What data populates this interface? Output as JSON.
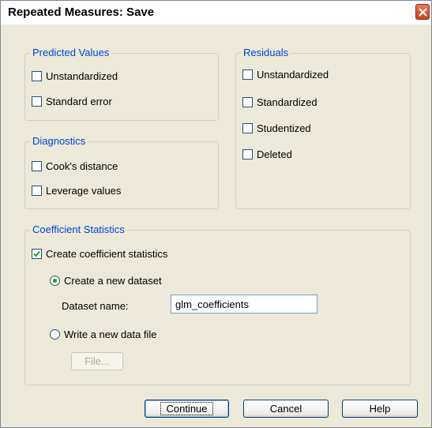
{
  "window": {
    "title": "Repeated Measures: Save"
  },
  "predicted_values": {
    "title": "Predicted Values",
    "options": [
      {
        "label": "Unstandardized",
        "checked": false
      },
      {
        "label": "Standard error",
        "checked": false
      }
    ]
  },
  "diagnostics": {
    "title": "Diagnostics",
    "options": [
      {
        "label": "Cook's distance",
        "checked": false
      },
      {
        "label": "Leverage values",
        "checked": false
      }
    ]
  },
  "residuals": {
    "title": "Residuals",
    "options": [
      {
        "label": "Unstandardized",
        "checked": false
      },
      {
        "label": "Standardized",
        "checked": false
      },
      {
        "label": "Studentized",
        "checked": false
      },
      {
        "label": "Deleted",
        "checked": false
      }
    ]
  },
  "coefficient_statistics": {
    "title": "Coefficient Statistics",
    "create_checkbox": {
      "label": "Create coefficient statistics",
      "checked": true
    },
    "create_dataset_radio": {
      "label": "Create a new dataset",
      "selected": true
    },
    "dataset_name_label": "Dataset name:",
    "dataset_name_value": "glm_coefficients",
    "write_file_radio": {
      "label": "Write a new data file",
      "selected": false
    },
    "file_button": "File..."
  },
  "buttons": {
    "continue": "Continue",
    "cancel": "Cancel",
    "help": "Help"
  },
  "colors": {
    "group_title": "#0046d5",
    "dialog_background": "#ece9d8",
    "check_mark": "#21a121"
  }
}
